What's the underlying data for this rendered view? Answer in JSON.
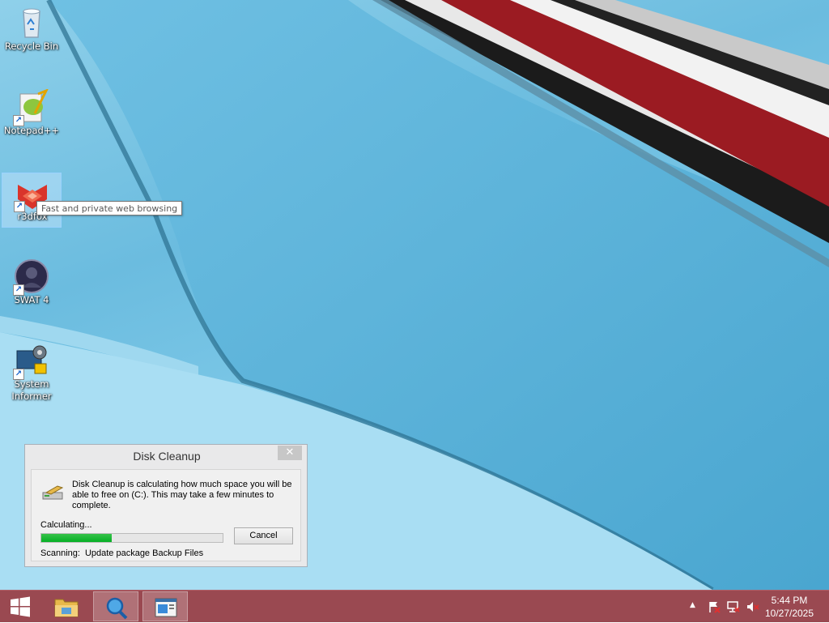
{
  "desktop": {
    "icons": [
      {
        "label": "Recycle Bin",
        "icon": "recycle-bin-icon",
        "shortcut": false
      },
      {
        "label": "Notepad++",
        "icon": "notepad-plus-plus-icon",
        "shortcut": true
      },
      {
        "label": "r3dfox",
        "icon": "r3dfox-icon",
        "shortcut": true,
        "selected": true
      },
      {
        "label": "SWAT 4",
        "icon": "swat4-icon",
        "shortcut": true
      },
      {
        "label": "System Informer",
        "label_line1": "System",
        "label_line2": "Informer",
        "icon": "system-informer-icon",
        "shortcut": true
      }
    ],
    "tooltip": "Fast and private web browsing"
  },
  "dialog": {
    "title": "Disk Cleanup",
    "close_glyph": "✕",
    "message": "Disk Cleanup is calculating how much space you will be able to free on  (C:). This may take a few minutes to complete.",
    "status": "Calculating...",
    "progress": 0.39,
    "cancel_label": "Cancel",
    "scanning_label": "Scanning:",
    "scanning_item": "Update package Backup Files"
  },
  "taskbar": {
    "start_icon": "windows-start-icon",
    "pinned": [
      {
        "name": "file-explorer",
        "icon": "folder-icon",
        "active": false
      },
      {
        "name": "search-app",
        "icon": "magnifier-icon",
        "active": true
      },
      {
        "name": "disk-cleanup",
        "icon": "disk-cleanup-icon",
        "active": true
      }
    ],
    "tray": {
      "show_hidden_glyph": "▲",
      "icons": [
        "action-center-flag-icon",
        "network-icon",
        "volume-muted-icon"
      ]
    },
    "clock": {
      "time": "5:44 PM",
      "date": "10/27/2025"
    }
  },
  "colors": {
    "taskbar": "#9a4951",
    "progress": "#06b025",
    "wallpaper": "#6bbcdf"
  }
}
